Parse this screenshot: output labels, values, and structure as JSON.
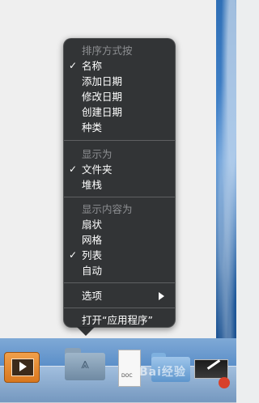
{
  "menu": {
    "sections": [
      {
        "header": "排序方式按",
        "items": [
          {
            "label": "名称",
            "checked": true
          },
          {
            "label": "添加日期",
            "checked": false
          },
          {
            "label": "修改日期",
            "checked": false
          },
          {
            "label": "创建日期",
            "checked": false
          },
          {
            "label": "种类",
            "checked": false
          }
        ]
      },
      {
        "header": "显示为",
        "items": [
          {
            "label": "文件夹",
            "checked": true
          },
          {
            "label": "堆栈",
            "checked": false
          }
        ]
      },
      {
        "header": "显示内容为",
        "items": [
          {
            "label": "扇状",
            "checked": false
          },
          {
            "label": "网格",
            "checked": false
          },
          {
            "label": "列表",
            "checked": true
          },
          {
            "label": "自动",
            "checked": false
          }
        ]
      }
    ],
    "options_label": "选项",
    "open_label": "打开“应用程序”",
    "check_glyph": "✓"
  },
  "dock": {
    "doc_tag": "DOC",
    "watermark": "Bai经验"
  }
}
